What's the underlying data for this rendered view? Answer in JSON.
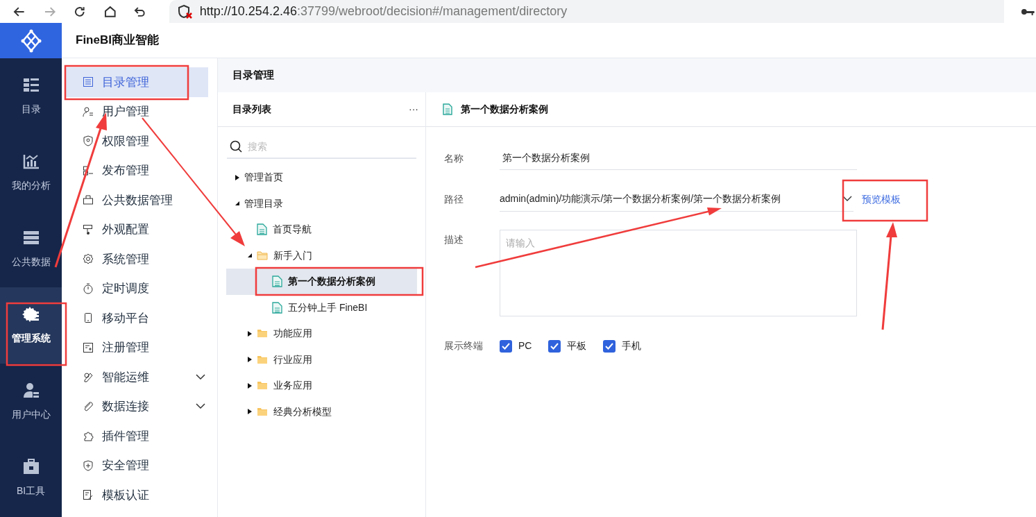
{
  "browser": {
    "url_host": "http://10.254.2.46",
    "url_rest": ":37799/webroot/decision#/management/directory"
  },
  "app_title": "FineBI商业智能",
  "rail_items": [
    {
      "label": "目录",
      "selected": false
    },
    {
      "label": "我的分析",
      "selected": false
    },
    {
      "label": "公共数据",
      "selected": false
    },
    {
      "label": "管理系统",
      "selected": true
    },
    {
      "label": "用户中心",
      "selected": false
    },
    {
      "label": "BI工具",
      "selected": false
    }
  ],
  "nav_items": [
    {
      "label": "目录管理",
      "selected": true,
      "expandable": false
    },
    {
      "label": "用户管理",
      "selected": false,
      "expandable": false
    },
    {
      "label": "权限管理",
      "selected": false,
      "expandable": false
    },
    {
      "label": "发布管理",
      "selected": false,
      "expandable": false
    },
    {
      "label": "公共数据管理",
      "selected": false,
      "expandable": false
    },
    {
      "label": "外观配置",
      "selected": false,
      "expandable": false
    },
    {
      "label": "系统管理",
      "selected": false,
      "expandable": false
    },
    {
      "label": "定时调度",
      "selected": false,
      "expandable": false
    },
    {
      "label": "移动平台",
      "selected": false,
      "expandable": false
    },
    {
      "label": "注册管理",
      "selected": false,
      "expandable": false
    },
    {
      "label": "智能运维",
      "selected": false,
      "expandable": true
    },
    {
      "label": "数据连接",
      "selected": false,
      "expandable": true
    },
    {
      "label": "插件管理",
      "selected": false,
      "expandable": false
    },
    {
      "label": "安全管理",
      "selected": false,
      "expandable": false
    },
    {
      "label": "模板认证",
      "selected": false,
      "expandable": false
    }
  ],
  "breadcrumb": "目录管理",
  "tree_panel": {
    "title": "目录列表",
    "more": "···",
    "search_placeholder": "搜索",
    "nodes": [
      {
        "label": "管理首页",
        "kind": "group",
        "expanded": false,
        "selected": false
      },
      {
        "label": "管理目录",
        "kind": "group",
        "expanded": true,
        "selected": false,
        "children": [
          {
            "label": "首页导航",
            "kind": "file",
            "selected": false
          },
          {
            "label": "新手入门",
            "kind": "folder",
            "expanded": true,
            "selected": false,
            "children": [
              {
                "label": "第一个数据分析案例",
                "kind": "file",
                "selected": true
              },
              {
                "label": "五分钟上手 FineBI",
                "kind": "file",
                "selected": false
              }
            ]
          },
          {
            "label": "功能应用",
            "kind": "folder",
            "expanded": false,
            "selected": false
          },
          {
            "label": "行业应用",
            "kind": "folder",
            "expanded": false,
            "selected": false
          },
          {
            "label": "业务应用",
            "kind": "folder",
            "expanded": false,
            "selected": false
          },
          {
            "label": "经典分析模型",
            "kind": "folder",
            "expanded": false,
            "selected": false
          }
        ]
      }
    ]
  },
  "detail": {
    "title": "第一个数据分析案例",
    "name_label": "名称",
    "name_value": "第一个数据分析案例",
    "path_label": "路径",
    "path_value": "admin(admin)/功能演示/第一个数据分析案例/第一个数据分析案例",
    "preview_link": "预览模板",
    "description_label": "描述",
    "description_placeholder": "请输入",
    "terminals_label": "展示终端",
    "terminals": [
      {
        "label": "PC",
        "checked": true
      },
      {
        "label": "平板",
        "checked": true
      },
      {
        "label": "手机",
        "checked": true
      }
    ]
  }
}
